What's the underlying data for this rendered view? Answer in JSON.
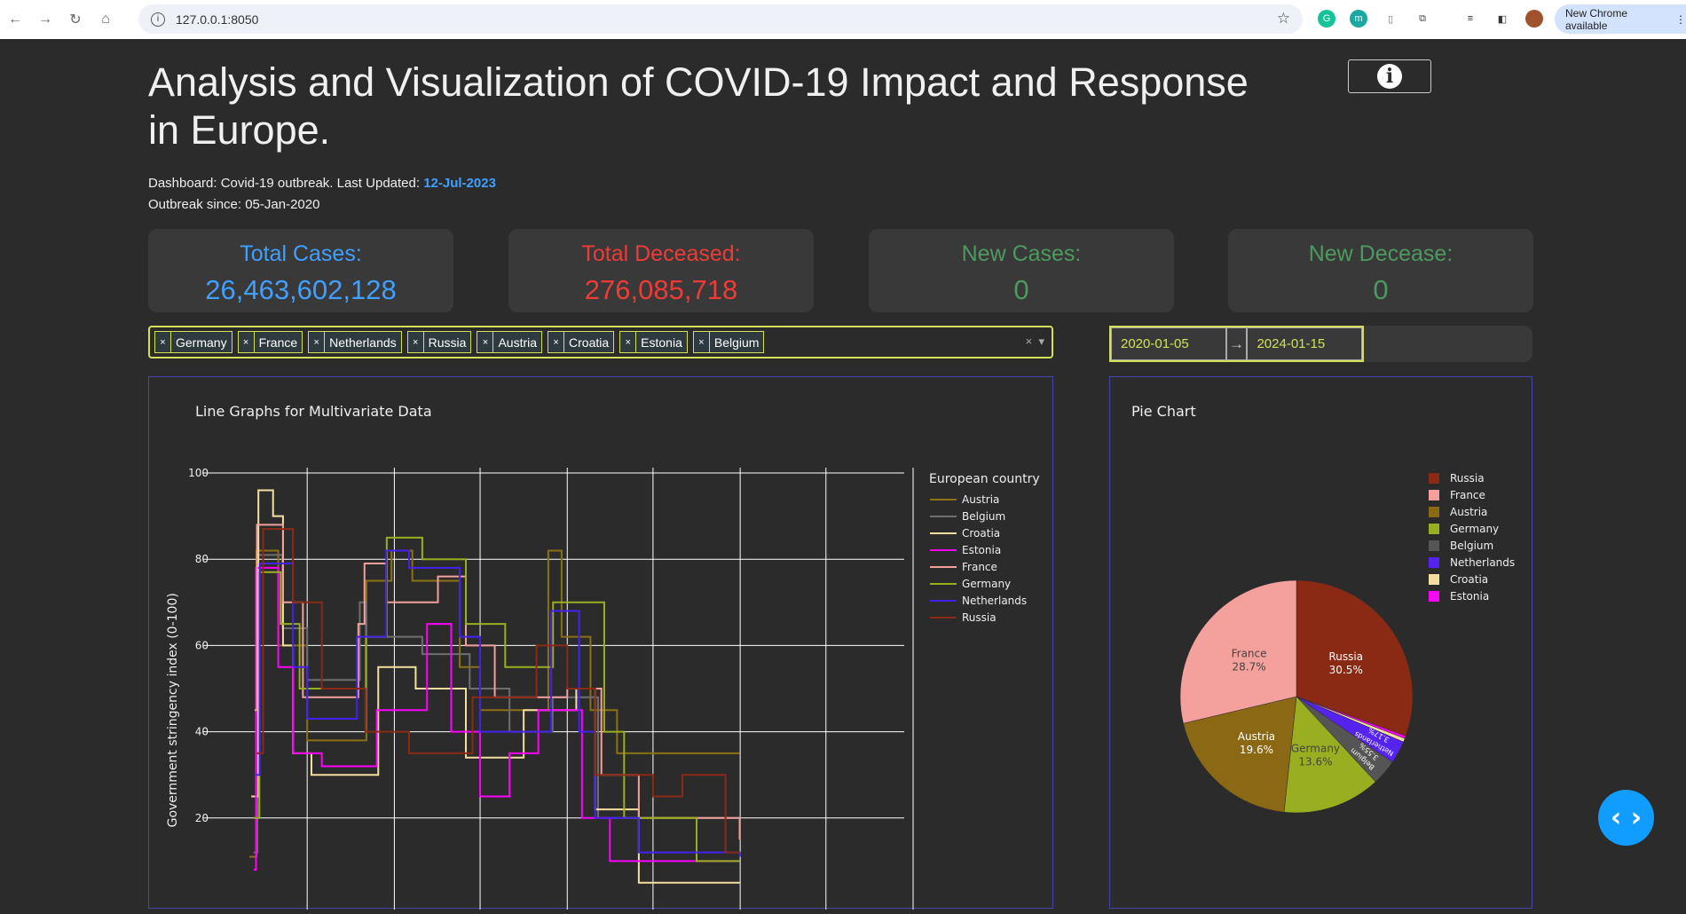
{
  "browser": {
    "url": "127.0.0.1:8050",
    "new_chrome": "New Chrome available"
  },
  "header": {
    "title": "Analysis and Visualization of COVID-19 Impact and Response in Europe.",
    "dashboard_prefix": "Dashboard: Covid-19 outbreak. Last Updated: ",
    "last_updated": "12-Jul-2023",
    "outbreak_since": "Outbreak since: 05-Jan-2020",
    "info_icon": "info-icon"
  },
  "cards": [
    {
      "label": "Total Cases:",
      "value": "26,463,602,128",
      "color": "#3fa0ff"
    },
    {
      "label": "Total Deceased:",
      "value": "276,085,718",
      "color": "#ef3b36"
    },
    {
      "label": "New Cases:",
      "value": "0",
      "color": "#4c9a5f"
    },
    {
      "label": "New Decease:",
      "value": "0",
      "color": "#4c9a5f"
    }
  ],
  "country_select": {
    "selected": [
      "Germany",
      "France",
      "Netherlands",
      "Russia",
      "Austria",
      "Croatia",
      "Estonia",
      "Belgium"
    ],
    "remove_glyph": "×",
    "clear_glyph": "×",
    "arrow_glyph": "▾"
  },
  "date_range": {
    "start": "2020-01-05",
    "end": "2024-01-15",
    "arrow": "→"
  },
  "chart_data": [
    {
      "type": "line",
      "title": "Line Graphs for Multivariate Data",
      "ylabel": "Government stringency index (0-100)",
      "ylim": [
        0,
        100
      ],
      "yticks": [
        20,
        40,
        60,
        80,
        100
      ],
      "xlim": [
        "2020-01-01",
        "2024-01-01"
      ],
      "grid": true,
      "legend_title": "European country",
      "legend_position": "right",
      "series": [
        {
          "name": "Austria",
          "color": "#8b7014",
          "points": [
            [
              "2020-03-01",
              11
            ],
            [
              "2020-03-16",
              82
            ],
            [
              "2020-05-01",
              60
            ],
            [
              "2020-07-01",
              38
            ],
            [
              "2020-11-03",
              75
            ],
            [
              "2020-12-26",
              82
            ],
            [
              "2021-02-08",
              75
            ],
            [
              "2021-05-19",
              55
            ],
            [
              "2021-07-01",
              45
            ],
            [
              "2021-11-22",
              82
            ],
            [
              "2021-12-20",
              62
            ],
            [
              "2022-02-19",
              45
            ],
            [
              "2022-04-16",
              35
            ],
            [
              "2022-12-31",
              35
            ]
          ]
        },
        {
          "name": "Belgium",
          "color": "#6e6e6e",
          "points": [
            [
              "2020-03-10",
              12
            ],
            [
              "2020-03-18",
              81
            ],
            [
              "2020-05-10",
              64
            ],
            [
              "2020-07-01",
              52
            ],
            [
              "2020-10-20",
              70
            ],
            [
              "2020-11-02",
              62
            ],
            [
              "2021-03-01",
              58
            ],
            [
              "2021-06-09",
              50
            ],
            [
              "2021-09-01",
              40
            ],
            [
              "2021-12-01",
              48
            ],
            [
              "2022-03-07",
              20
            ],
            [
              "2022-12-31",
              15
            ]
          ]
        },
        {
          "name": "Croatia",
          "color": "#f5dfa0",
          "points": [
            [
              "2020-03-05",
              25
            ],
            [
              "2020-03-20",
              96
            ],
            [
              "2020-04-20",
              90
            ],
            [
              "2020-05-11",
              60
            ],
            [
              "2020-06-01",
              35
            ],
            [
              "2020-07-10",
              30
            ],
            [
              "2020-11-28",
              55
            ],
            [
              "2021-02-15",
              50
            ],
            [
              "2021-06-01",
              34
            ],
            [
              "2021-10-01",
              45
            ],
            [
              "2022-01-20",
              50
            ],
            [
              "2022-03-01",
              22
            ],
            [
              "2022-06-01",
              5
            ],
            [
              "2022-12-31",
              5
            ]
          ]
        },
        {
          "name": "Estonia",
          "color": "#ff00ff",
          "points": [
            [
              "2020-03-10",
              8
            ],
            [
              "2020-03-15",
              78
            ],
            [
              "2020-05-01",
              55
            ],
            [
              "2020-06-01",
              35
            ],
            [
              "2020-08-01",
              32
            ],
            [
              "2020-11-25",
              45
            ],
            [
              "2021-03-11",
              65
            ],
            [
              "2021-05-01",
              40
            ],
            [
              "2021-07-01",
              25
            ],
            [
              "2021-09-01",
              35
            ],
            [
              "2021-11-01",
              45
            ],
            [
              "2022-02-01",
              20
            ],
            [
              "2022-04-01",
              10
            ],
            [
              "2022-12-31",
              10
            ]
          ]
        },
        {
          "name": "France",
          "color": "#f4a09c",
          "points": [
            [
              "2020-03-12",
              45
            ],
            [
              "2020-03-17",
              88
            ],
            [
              "2020-05-11",
              70
            ],
            [
              "2020-06-22",
              48
            ],
            [
              "2020-10-17",
              65
            ],
            [
              "2020-10-30",
              79
            ],
            [
              "2020-12-15",
              70
            ],
            [
              "2021-04-03",
              76
            ],
            [
              "2021-06-01",
              60
            ],
            [
              "2021-08-01",
              48
            ],
            [
              "2022-01-01",
              50
            ],
            [
              "2022-03-14",
              30
            ],
            [
              "2022-06-01",
              20
            ],
            [
              "2022-12-31",
              15
            ]
          ]
        },
        {
          "name": "Germany",
          "color": "#9aaf1f",
          "points": [
            [
              "2020-03-10",
              20
            ],
            [
              "2020-03-22",
              77
            ],
            [
              "2020-05-06",
              65
            ],
            [
              "2020-06-15",
              50
            ],
            [
              "2020-11-02",
              62
            ],
            [
              "2020-12-16",
              85
            ],
            [
              "2021-03-01",
              80
            ],
            [
              "2021-06-01",
              65
            ],
            [
              "2021-08-23",
              55
            ],
            [
              "2021-12-02",
              70
            ],
            [
              "2022-03-20",
              40
            ],
            [
              "2022-05-01",
              20
            ],
            [
              "2022-10-01",
              10
            ],
            [
              "2022-12-31",
              10
            ]
          ]
        },
        {
          "name": "Netherlands",
          "color": "#4422ee",
          "points": [
            [
              "2020-03-12",
              30
            ],
            [
              "2020-03-23",
              79
            ],
            [
              "2020-06-01",
              55
            ],
            [
              "2020-07-01",
              43
            ],
            [
              "2020-10-14",
              62
            ],
            [
              "2020-12-15",
              82
            ],
            [
              "2021-02-01",
              78
            ],
            [
              "2021-05-19",
              62
            ],
            [
              "2021-07-01",
              40
            ],
            [
              "2021-11-28",
              68
            ],
            [
              "2022-01-26",
              40
            ],
            [
              "2022-03-01",
              20
            ],
            [
              "2022-06-01",
              12
            ],
            [
              "2022-12-31",
              11
            ]
          ]
        },
        {
          "name": "Russia",
          "color": "#8b2a14",
          "points": [
            [
              "2020-03-16",
              35
            ],
            [
              "2020-03-30",
              87
            ],
            [
              "2020-06-01",
              70
            ],
            [
              "2020-08-01",
              50
            ],
            [
              "2020-11-01",
              40
            ],
            [
              "2021-02-01",
              35
            ],
            [
              "2021-06-15",
              48
            ],
            [
              "2021-10-28",
              60
            ],
            [
              "2022-01-01",
              50
            ],
            [
              "2022-03-01",
              30
            ],
            [
              "2022-07-01",
              25
            ],
            [
              "2022-09-01",
              30
            ],
            [
              "2022-12-01",
              12
            ],
            [
              "2022-12-31",
              12
            ]
          ]
        }
      ]
    },
    {
      "type": "pie",
      "title": "Pie Chart",
      "legend_position": "top-right",
      "direction": "clockwise",
      "slices": [
        {
          "label": "Russia",
          "value": 30.5,
          "text": "30.5%",
          "color": "#8b2a14"
        },
        {
          "label": "Estonia",
          "value": 0.38,
          "text": "",
          "color": "#ff00ff"
        },
        {
          "label": "Croatia",
          "value": 0.5,
          "text": "",
          "color": "#f5dfa0"
        },
        {
          "label": "Netherlands",
          "value": 3.17,
          "text": "3.17%",
          "color": "#5522ee"
        },
        {
          "label": "Belgium",
          "value": 3.55,
          "text": "3.55%",
          "color": "#555555"
        },
        {
          "label": "Germany",
          "value": 13.6,
          "text": "13.6%",
          "color": "#9aaf1f"
        },
        {
          "label": "Austria",
          "value": 19.6,
          "text": "19.6%",
          "color": "#8b6914"
        },
        {
          "label": "France",
          "value": 28.7,
          "text": "28.7%",
          "color": "#f4a09c"
        }
      ],
      "legend_order": [
        "Russia",
        "France",
        "Austria",
        "Germany",
        "Belgium",
        "Netherlands",
        "Croatia",
        "Estonia"
      ]
    }
  ]
}
